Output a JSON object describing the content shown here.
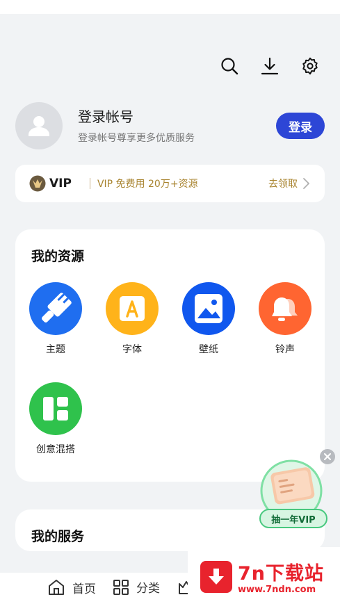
{
  "header": {
    "icons": [
      "search-icon",
      "download-icon",
      "settings-icon"
    ]
  },
  "account": {
    "title": "登录帐号",
    "subtitle": "登录帐号尊享更多优质服务",
    "login_label": "登录"
  },
  "vip": {
    "badge": "VIP",
    "promo": "VIP 免费用 20万+资源",
    "claim": "去领取"
  },
  "resources": {
    "title": "我的资源",
    "items": [
      {
        "label": "主题",
        "color": "#1f6ef0",
        "icon": "brush-icon"
      },
      {
        "label": "字体",
        "color": "#ffb31a",
        "icon": "font-icon"
      },
      {
        "label": "壁纸",
        "color": "#1057ee",
        "icon": "image-icon"
      },
      {
        "label": "铃声",
        "color": "#ff6531",
        "icon": "bell-icon"
      },
      {
        "label": "创意混搭",
        "color": "#2fc24c",
        "icon": "mix-icon"
      }
    ]
  },
  "services": {
    "title": "我的服务"
  },
  "floating": {
    "label": "抽一年VIP"
  },
  "bottom_nav": [
    {
      "label": "首页",
      "icon": "home-icon"
    },
    {
      "label": "分类",
      "icon": "grid-icon"
    }
  ],
  "watermark": {
    "title": "7n下载站",
    "url": "www.7ndn.com"
  }
}
